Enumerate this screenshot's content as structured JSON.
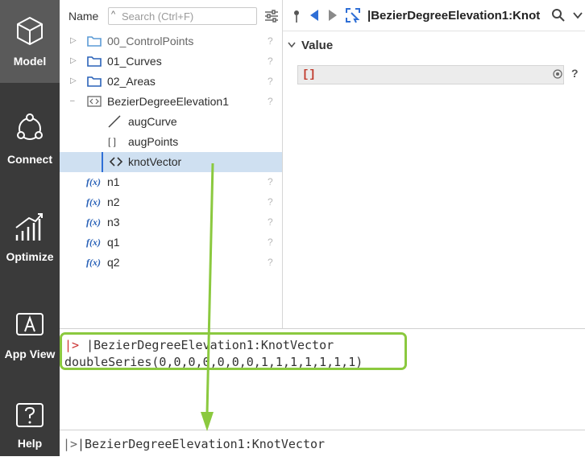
{
  "rail": {
    "items": [
      {
        "label": "Model",
        "icon": "cube-icon"
      },
      {
        "label": "Connect",
        "icon": "connect-icon"
      },
      {
        "label": "Optimize",
        "icon": "chart-icon"
      },
      {
        "label": "App View",
        "icon": "app-view-icon"
      },
      {
        "label": "Help",
        "icon": "help-icon"
      }
    ]
  },
  "tree": {
    "name_label": "Name",
    "search_placeholder": "Search (Ctrl+F)",
    "rows": [
      {
        "label": "00_ControlPoints",
        "kind": "folder",
        "expander": "▷",
        "help": "?"
      },
      {
        "label": "01_Curves",
        "kind": "folder",
        "expander": "▷",
        "help": "?"
      },
      {
        "label": "02_Areas",
        "kind": "folder",
        "expander": "▷",
        "help": "?"
      },
      {
        "label": "BezierDegreeElevation1",
        "kind": "component",
        "expander": "–",
        "help": "?"
      },
      {
        "label": "augCurve",
        "kind": "line",
        "help": ""
      },
      {
        "label": "augPoints",
        "kind": "array",
        "help": ""
      },
      {
        "label": "knotVector",
        "kind": "code",
        "help": ""
      },
      {
        "label": "n1",
        "kind": "fx",
        "help": "?"
      },
      {
        "label": "n2",
        "kind": "fx",
        "help": "?"
      },
      {
        "label": "n3",
        "kind": "fx",
        "help": "?"
      },
      {
        "label": "q1",
        "kind": "fx",
        "help": "?"
      },
      {
        "label": "q2",
        "kind": "fx",
        "help": "?"
      }
    ],
    "fx_label": "f(x)",
    "array_glyph": "[ ]"
  },
  "props": {
    "title": "|BezierDegreeElevation1:Knot",
    "value_label": "Value",
    "value_text": "[]",
    "help": "?"
  },
  "console": {
    "out_prompt": "|>",
    "out_line1": " |BezierDegreeElevation1:KnotVector",
    "out_line2": "doubleSeries(0,0,0,0,0,0,0,1,1,1,1,1,1,1)",
    "input_prompt": "|>",
    "input_value": "|BezierDegreeElevation1:KnotVector"
  },
  "colors": {
    "rail_bg": "#3a3a3a",
    "accent": "#2f6fd6",
    "highlight": "#8bc93f",
    "selected_row": "#cfe0f1"
  }
}
